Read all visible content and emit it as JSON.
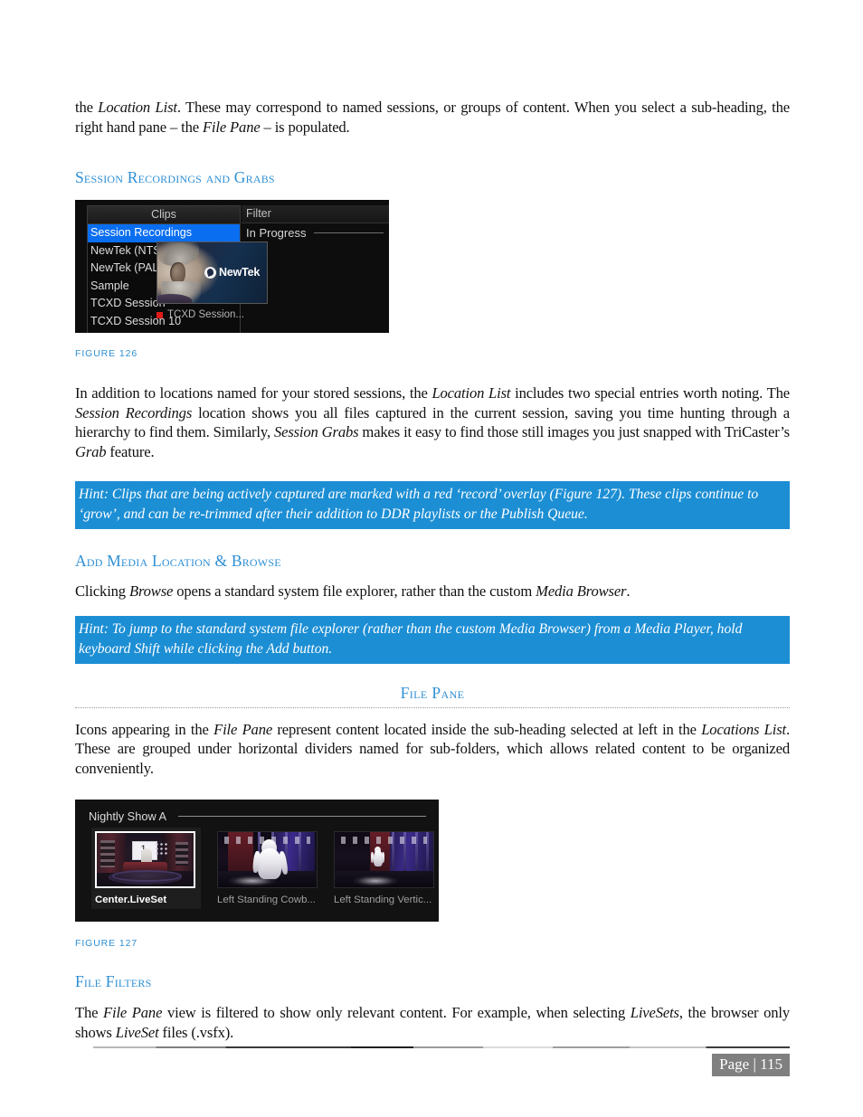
{
  "page": {
    "footer_page_label": "Page | 115"
  },
  "paragraphs": {
    "intro_a": "the ",
    "intro_b": "Location List",
    "intro_c": ".  These may correspond to named sessions, or groups of content.  When you select a sub-heading, the right hand pane – the ",
    "intro_d": "File Pane",
    "intro_e": " – is populated.",
    "special_a": "In addition to locations named for your stored sessions, the ",
    "special_b": "Location List",
    "special_c": " includes two special entries worth noting.  The ",
    "special_d": "Session Recordings",
    "special_e": " location shows you all files captured in the current session, saving you time hunting through a hierarchy to find them.  Similarly, ",
    "special_f": "Session Grabs",
    "special_g": " makes it easy to find those still images you just snapped with TriCaster’s ",
    "special_h": "Grab",
    "special_i": " feature.",
    "browse_a": "Clicking ",
    "browse_b": "Browse",
    "browse_c": " opens a standard system file explorer, rather than the custom ",
    "browse_d": "Media Browser",
    "browse_e": ".",
    "filepane_a": "Icons appearing in the ",
    "filepane_b": "File Pane",
    "filepane_c": " represent content located inside the sub-heading selected at left in the ",
    "filepane_d": "Locations List",
    "filepane_e": ".  These are grouped under horizontal dividers named for sub-folders, which allows related content to be organized conveniently.",
    "filters_a": "The ",
    "filters_b": "File Pane",
    "filters_c": " view is filtered to show only relevant content. For example, when selecting ",
    "filters_d": "LiveSets",
    "filters_e": ", the browser only shows ",
    "filters_f": "LiveSet",
    "filters_g": " files (.vsfx)."
  },
  "headings": {
    "session_recordings_and_grabs": "Session Recordings and Grabs",
    "add_media_location_and_browse": "Add Media Location & Browse",
    "file_pane": "File Pane",
    "file_filters": "File Filters"
  },
  "captions": {
    "figure_126": "FIGURE 126",
    "figure_127": "FIGURE 127"
  },
  "hints": {
    "hint_1": "Hint: Clips that are being actively captured are marked with a red ‘record’ overlay (Figure 127).  These clips continue to ‘grow’, and can be re-trimmed after their addition to DDR playlists or the Publish Queue.",
    "hint_2": "Hint: To jump to the standard system file explorer (rather than the custom Media Browser) from a Media Player, hold keyboard Shift while clicking the Add button."
  },
  "figure126": {
    "left_header": "Clips",
    "items": [
      {
        "label": "Session Recordings",
        "selected": true
      },
      {
        "label": "NewTek (NTSC)",
        "selected": false
      },
      {
        "label": "NewTek (PAL)",
        "selected": false
      },
      {
        "label": "Sample",
        "selected": false
      },
      {
        "label": "TCXD Session",
        "selected": false
      },
      {
        "label": "TCXD Session 10",
        "selected": false
      }
    ],
    "right_header": "Filter",
    "group_divider": "In Progress",
    "thumbnail_logo": "NewTek",
    "file_label": "TCXD Session...",
    "record_color": "#e11919",
    "selection_color": "#0a6ef0"
  },
  "figure127": {
    "group_divider": "Nightly Show A",
    "items": [
      {
        "label": "Center.LiveSet",
        "selected": true
      },
      {
        "label": "Left Standing Cowb...",
        "selected": false
      },
      {
        "label": "Left Standing Vertic...",
        "selected": false
      }
    ]
  },
  "colors": {
    "heading_blue": "#2e8fd4",
    "hint_background": "#1c8ed4",
    "hint_text": "#ffffff",
    "footer_badge": "#808080"
  }
}
